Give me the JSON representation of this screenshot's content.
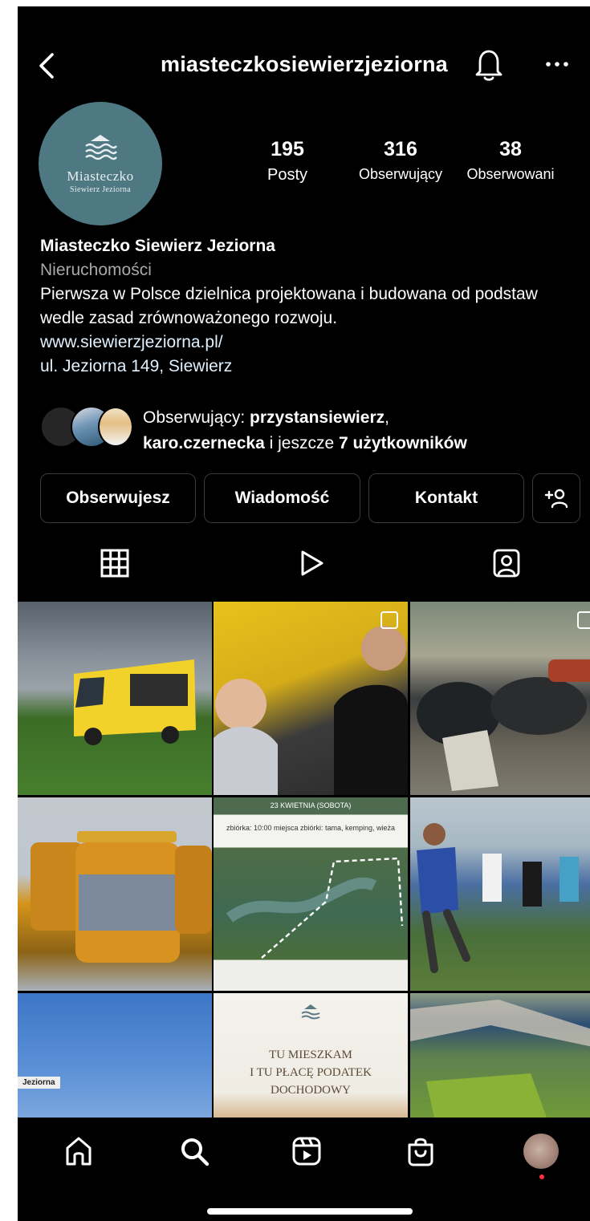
{
  "header": {
    "username": "miasteczkosiewierzjeziorna"
  },
  "avatar_logo": {
    "line1": "Miasteczko",
    "line2": "Siewierz Jeziorna"
  },
  "stats": [
    {
      "value": "195",
      "label": "Posty"
    },
    {
      "value": "316",
      "label": "Obserwujący"
    },
    {
      "value": "38",
      "label": "Obserwowani"
    }
  ],
  "bio": {
    "name": "Miasteczko Siewierz Jeziorna",
    "category": "Nieruchomości",
    "description": "Pierwsza w Polsce dzielnica projektowana i budowana od podstaw wedle zasad zrównoważonego rozwoju.",
    "link": "www.siewierzjeziorna.pl/",
    "address": "ul. Jeziorna 149, Siewierz"
  },
  "followed_by": {
    "prefix": "Obserwujący: ",
    "user1": "przystansiewierz",
    "sep": ",",
    "user2": "karo.czernecka",
    "middle": " i jeszcze ",
    "more": "7 użytkowników"
  },
  "buttons": {
    "following": "Obserwujesz",
    "message": "Wiadomość",
    "contact": "Kontakt",
    "suggest_icon": "add-person-icon"
  },
  "tabs": [
    "grid-icon",
    "reels-icon",
    "tagged-icon"
  ],
  "posts": {
    "post5_date": "23 KWIETNIA (SOBOTA)",
    "post5_info": "zbiórka: 10:00 miejsca zbiórki: tama, kemping, wieża",
    "post7_sign": "Jeziorna",
    "post8_caption_1": "TU MIESZKAM",
    "post8_caption_2": "I TU PŁACĘ PODATEK DOCHODOWY"
  },
  "bottom_nav": [
    "home-icon",
    "search-icon",
    "reels-icon",
    "shop-icon",
    "profile-avatar"
  ],
  "colors": {
    "background": "#000000",
    "avatar_bg": "#4e7983",
    "link": "#e0f1ff",
    "notification_dot": "#ff3040"
  }
}
